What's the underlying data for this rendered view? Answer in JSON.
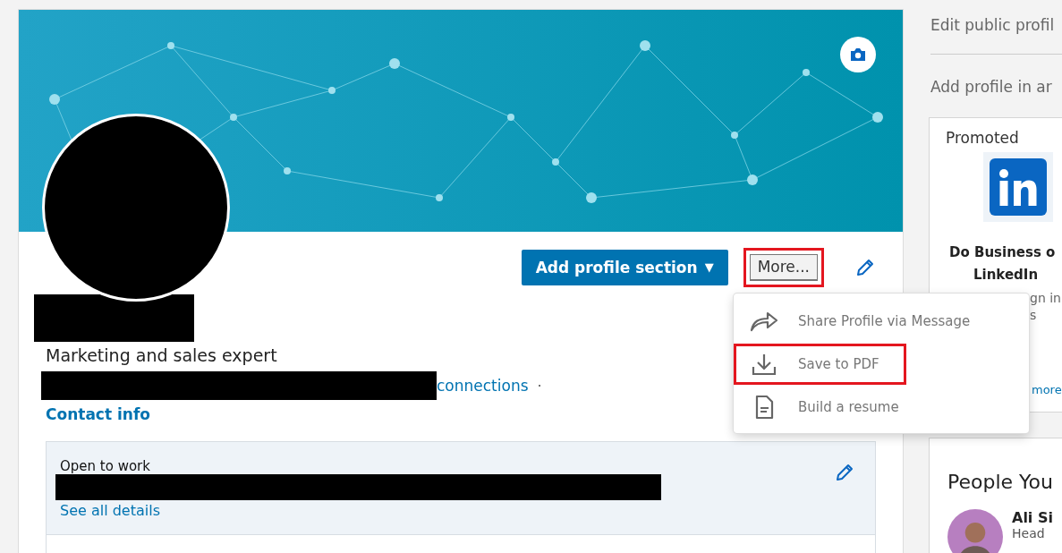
{
  "profile": {
    "actions": [
      {
        "kind": "dropdown",
        "label": "Add profile section",
        "caret": "▼",
        "highlighted": false
      },
      {
        "kind": "plain",
        "label": "More...",
        "highlighted": true,
        "expanded": true
      },
      {
        "kind": "edit"
      }
    ],
    "headline": "Marketing and sales expert",
    "connections_label": "connections",
    "separator": "·",
    "contact_link": "Contact info",
    "open_to_work": {
      "title": "Open to work",
      "link": "See all details"
    }
  },
  "more_menu": [
    {
      "kind": "share",
      "label": "Share Profile via Message",
      "highlighted": false
    },
    {
      "kind": "download",
      "label": "Save to PDF",
      "highlighted": true
    },
    {
      "kind": "document",
      "label": "Build a resume",
      "highlighted": false
    }
  ],
  "sidebar": {
    "links": [
      "Edit public profil",
      "Add profile in ar"
    ],
    "promoted": {
      "label": "Promoted",
      "title_lines": [
        "Do Business o",
        "LinkedIn"
      ],
      "fragments": [
        "gn in",
        "s"
      ],
      "link": "more"
    },
    "people": {
      "title": "People You",
      "person": {
        "name": "Ali Si",
        "subtitle": "Head"
      }
    }
  }
}
